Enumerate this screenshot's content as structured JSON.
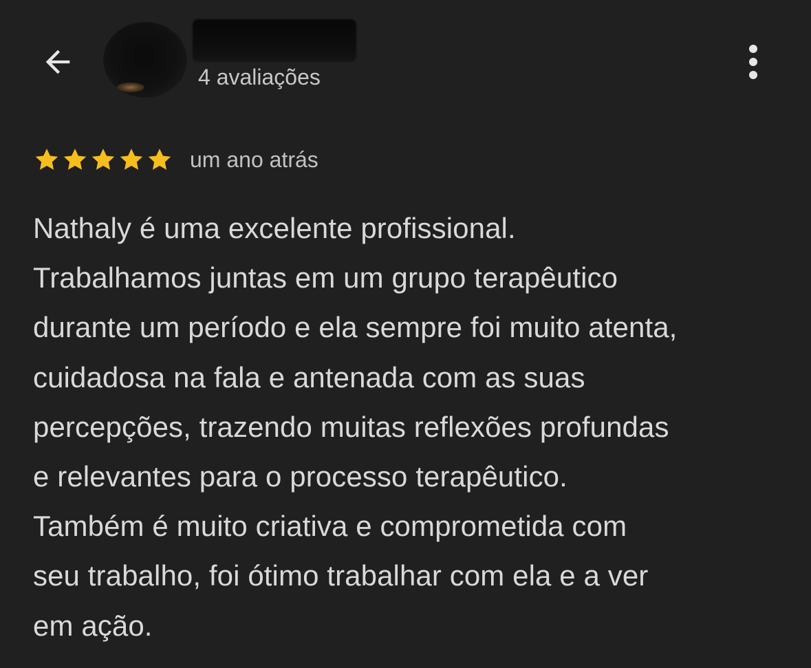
{
  "header": {
    "back_icon": "arrow-back-icon",
    "reviewer_name": "",
    "review_count": "4 avaliações",
    "more_icon": "more-vert-icon"
  },
  "review": {
    "rating": 5,
    "rating_max": 5,
    "star_color": "#f6be1c",
    "time_ago": "um ano atrás",
    "lines": [
      "Nathaly é uma excelente profissional.",
      "Trabalhamos juntas em um grupo terapêutico",
      "durante um período e ela sempre foi muito atenta,",
      "cuidadosa na fala e antenada com as suas",
      "percepções, trazendo muitas reflexões profundas",
      "e relevantes para o processo terapêutico.",
      "Também é muito criativa e comprometida com",
      "seu trabalho, foi ótimo trabalhar com ela e a ver",
      "em ação."
    ]
  },
  "colors": {
    "background": "#202020",
    "text": "#d9d9d9",
    "secondary_text": "#c2c2c2",
    "icon": "#e6e6e6"
  }
}
